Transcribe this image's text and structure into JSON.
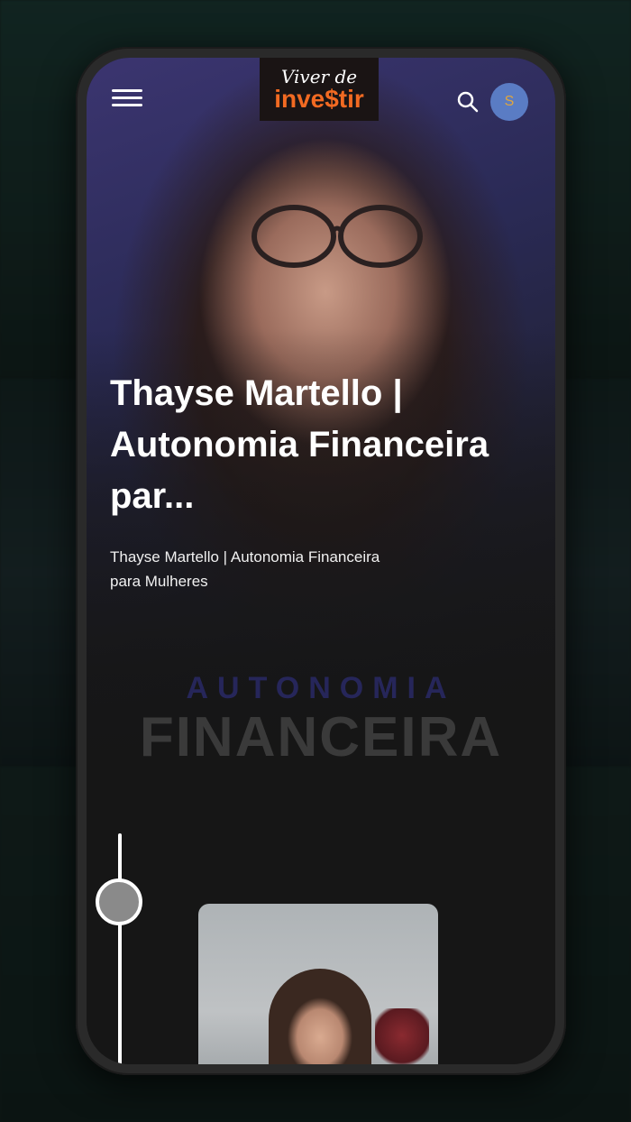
{
  "header": {
    "logo_top": "Viver de",
    "logo_bottom": "inve$tir",
    "avatar_initial": "S"
  },
  "hero": {
    "title": "Thayse Martello | Autonomia Financeira par...",
    "subtitle": "Thayse Martello | Autonomia Financeira para Mulheres",
    "brand_line1": "AUTONOMIA",
    "brand_line2": "FINANCEIRA"
  },
  "colors": {
    "accent": "#f26a22",
    "avatar_bg": "#5a7cc4",
    "avatar_text": "#e0a63e",
    "screen_bg": "#161616"
  },
  "icons": {
    "menu": "hamburger-menu-icon",
    "search": "search-icon"
  },
  "timeline": {
    "progress": 0
  }
}
